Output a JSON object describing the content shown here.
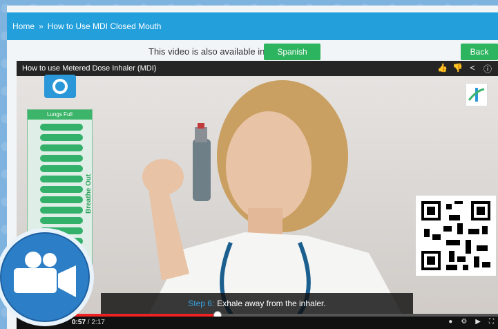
{
  "breadcrumb": {
    "home": "Home",
    "separator": "»",
    "current": "How to Use MDI Closed Mouth"
  },
  "availability": {
    "text": "This video is also available in",
    "language_button": "Spanish"
  },
  "back_button": "Back",
  "video": {
    "title": "How to use Metered Dose Inhaler (MDI)",
    "caption_step": "Step 6:",
    "caption_text": "Exhale away from the inhaler.",
    "time_current": "0:57",
    "time_total": "2:17",
    "progress_fraction": 0.416
  },
  "lungs_panel": {
    "header": "Lungs Full",
    "side_label": "Breathe Out",
    "filled_bars": 13
  },
  "colors": {
    "topbar": "#23a0dc",
    "green_button": "#2db45f",
    "progress": "#e22222",
    "caption_step": "#38a3e0"
  },
  "icons": [
    "like-icon",
    "dislike-icon",
    "share-icon",
    "info-icon",
    "settings-icon",
    "youtube-logo",
    "fullscreen-icon",
    "video-camera-icon"
  ]
}
